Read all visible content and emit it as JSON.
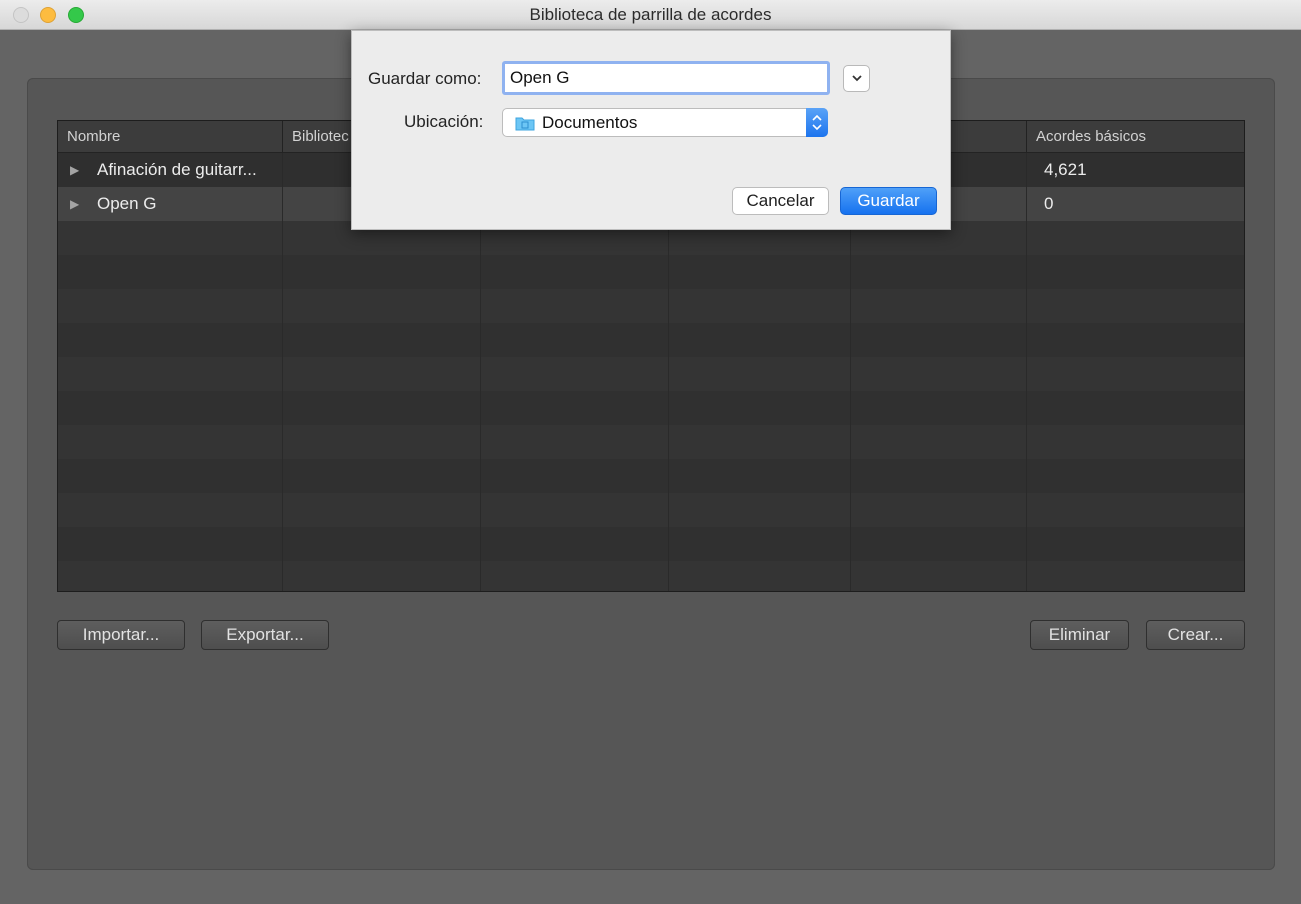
{
  "window": {
    "title": "Biblioteca de parrilla de acordes"
  },
  "table": {
    "columns": [
      "Nombre",
      "Bibliotec",
      "",
      "",
      "",
      "Acordes básicos"
    ],
    "rows": [
      {
        "name": "Afinación de guitarr...",
        "basic_chords": "4,621"
      },
      {
        "name": "Open G",
        "basic_chords": "0"
      }
    ]
  },
  "buttons": {
    "import": "Importar...",
    "export": "Exportar...",
    "delete": "Eliminar",
    "create": "Crear..."
  },
  "save_dialog": {
    "save_as_label": "Guardar como:",
    "save_as_value": "Open G",
    "location_label": "Ubicación:",
    "location_value": "Documentos",
    "cancel": "Cancelar",
    "save": "Guardar"
  },
  "colors": {
    "accent_blue": "#1672ef",
    "window_background": "#646464",
    "table_background": "#343434"
  },
  "icons": [
    "disclosure-triangle-icon",
    "chevron-down-icon",
    "folder-icon",
    "stepper-arrows-icon"
  ]
}
